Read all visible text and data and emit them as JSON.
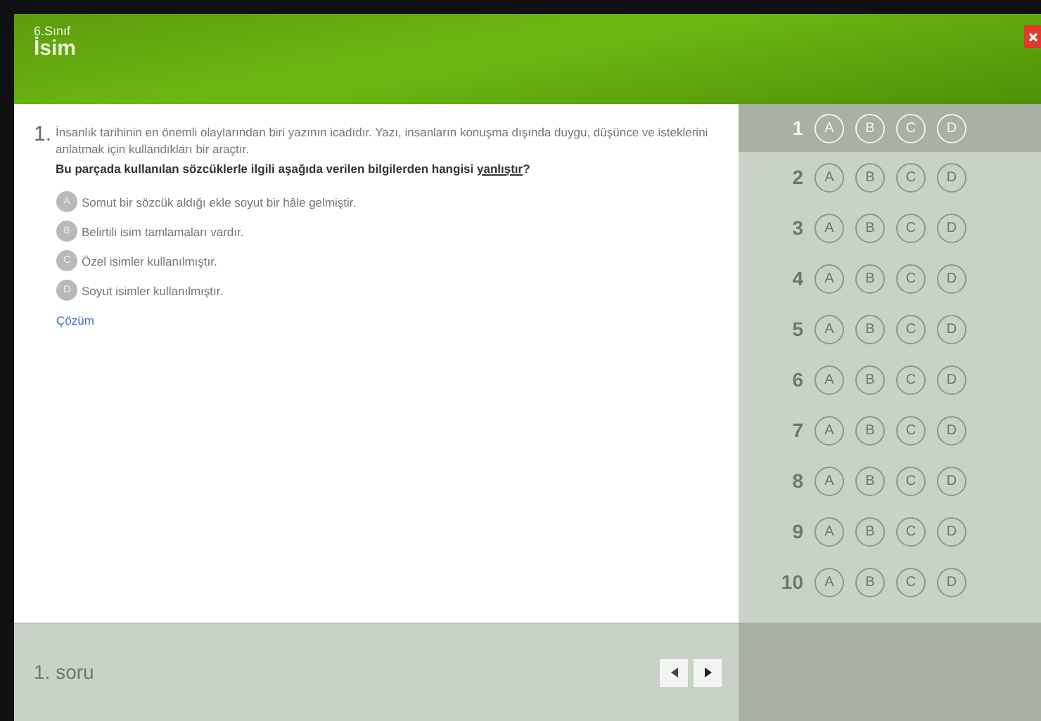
{
  "header": {
    "grade": "6.Sınıf",
    "title": "İsim"
  },
  "question": {
    "number": "1.",
    "passage": "İnsanlık tarihinin en önemli olaylarından biri yazının icadıdır. Yazı, insanların konuşma dışında duygu, düşünce ve isteklerini anlatmak için kullandıkları bir araçtır.",
    "prompt_before": "Bu parçada kullanılan sözcüklerle ilgili aşağıda verilen bilgilerden hangisi ",
    "prompt_underlined": "yanlıştır",
    "prompt_after": "?",
    "options": [
      {
        "letter": "A",
        "text": "Somut bir sözcük aldığı ekle soyut bir hâle gelmiştir."
      },
      {
        "letter": "B",
        "text": "Belirtili isim tamlamaları vardır."
      },
      {
        "letter": "C",
        "text": "Özel isimler kullanılmıştır."
      },
      {
        "letter": "D",
        "text": "Soyut isimler kullanılmıştır."
      }
    ],
    "solution_link": "Çözüm"
  },
  "answer_sheet": [
    {
      "number": "1",
      "selected": true,
      "choices": [
        "A",
        "B",
        "C",
        "D"
      ]
    },
    {
      "number": "2",
      "selected": false,
      "choices": [
        "A",
        "B",
        "C",
        "D"
      ]
    },
    {
      "number": "3",
      "selected": false,
      "choices": [
        "A",
        "B",
        "C",
        "D"
      ]
    },
    {
      "number": "4",
      "selected": false,
      "choices": [
        "A",
        "B",
        "C",
        "D"
      ]
    },
    {
      "number": "5",
      "selected": false,
      "choices": [
        "A",
        "B",
        "C",
        "D"
      ]
    },
    {
      "number": "6",
      "selected": false,
      "choices": [
        "A",
        "B",
        "C",
        "D"
      ]
    },
    {
      "number": "7",
      "selected": false,
      "choices": [
        "A",
        "B",
        "C",
        "D"
      ]
    },
    {
      "number": "8",
      "selected": false,
      "choices": [
        "A",
        "B",
        "C",
        "D"
      ]
    },
    {
      "number": "9",
      "selected": false,
      "choices": [
        "A",
        "B",
        "C",
        "D"
      ]
    },
    {
      "number": "10",
      "selected": false,
      "choices": [
        "A",
        "B",
        "C",
        "D"
      ]
    }
  ],
  "footer": {
    "status": "1. soru"
  }
}
